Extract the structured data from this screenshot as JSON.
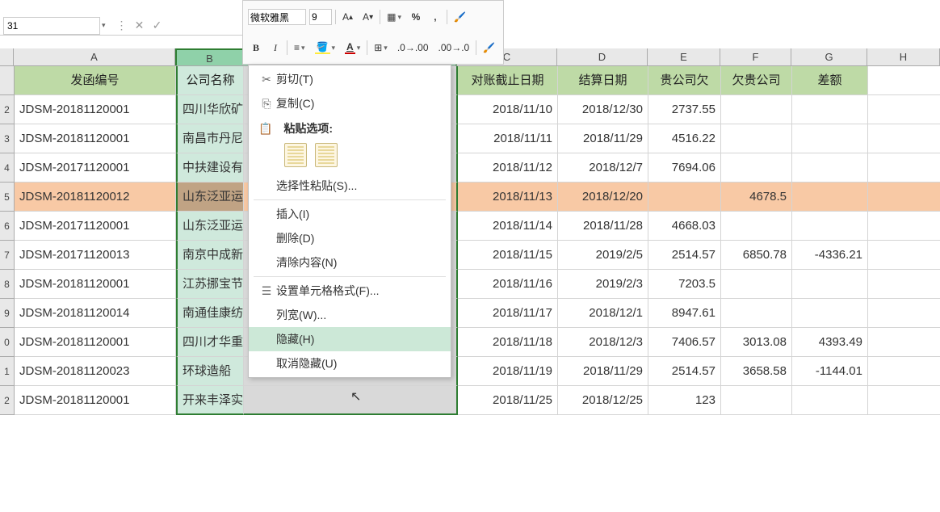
{
  "toolbar": {
    "font_name": "微软雅黑",
    "font_size": "9",
    "bold": "B",
    "italic": "I"
  },
  "namebox": {
    "value": "31"
  },
  "columns": [
    "A",
    "B",
    "C",
    "D",
    "E",
    "F",
    "G",
    "H"
  ],
  "header_row": {
    "A": "发函编号",
    "B": "公司名称",
    "C": "对账截止日期",
    "D": "结算日期",
    "E": "贵公司欠",
    "F": "欠贵公司",
    "G": "差额"
  },
  "rows": [
    {
      "rn": "2",
      "A": "JDSM-20181120001",
      "B": "四川华欣矿",
      "C": "2018/11/10",
      "D": "2018/12/30",
      "E": "2737.55",
      "F": "",
      "G": ""
    },
    {
      "rn": "3",
      "A": "JDSM-20181120001",
      "B": "南昌市丹尼",
      "C": "2018/11/11",
      "D": "2018/11/29",
      "E": "4516.22",
      "F": "",
      "G": ""
    },
    {
      "rn": "4",
      "A": "JDSM-20171120001",
      "B": "中扶建设有",
      "C": "2018/11/12",
      "D": "2018/12/7",
      "E": "7694.06",
      "F": "",
      "G": ""
    },
    {
      "rn": "5",
      "A": "JDSM-20181120012",
      "B": "山东泛亚运",
      "C": "2018/11/13",
      "D": "2018/12/20",
      "E": "",
      "F": "4678.5",
      "G": "",
      "orange": true
    },
    {
      "rn": "6",
      "A": "JDSM-20171120001",
      "B": "山东泛亚运",
      "C": "2018/11/14",
      "D": "2018/11/28",
      "E": "4668.03",
      "F": "",
      "G": ""
    },
    {
      "rn": "7",
      "A": "JDSM-20171120013",
      "B": "南京中成新",
      "C": "2018/11/15",
      "D": "2019/2/5",
      "E": "2514.57",
      "F": "6850.78",
      "G": "-4336.21"
    },
    {
      "rn": "8",
      "A": "JDSM-20181120001",
      "B": "江苏挪宝节",
      "C": "2018/11/16",
      "D": "2019/2/3",
      "E": "7203.5",
      "F": "",
      "G": ""
    },
    {
      "rn": "9",
      "A": "JDSM-20181120014",
      "B": "南通佳康纺",
      "C": "2018/11/17",
      "D": "2018/12/1",
      "E": "8947.61",
      "F": "",
      "G": ""
    },
    {
      "rn": "0",
      "A": "JDSM-20181120001",
      "B": "四川才华重",
      "C": "2018/11/18",
      "D": "2018/12/3",
      "E": "7406.57",
      "F": "3013.08",
      "G": "4393.49"
    },
    {
      "rn": "1",
      "A": "JDSM-20181120023",
      "B": "环球造船",
      "C": "2018/11/19",
      "D": "2018/11/29",
      "E": "2514.57",
      "F": "3658.58",
      "G": "-1144.01"
    },
    {
      "rn": "2",
      "A": "JDSM-20181120001",
      "B": "开来丰泽实",
      "C": "2018/11/25",
      "D": "2018/12/25",
      "E": "123",
      "F": "",
      "G": ""
    }
  ],
  "context_menu": {
    "cut": "剪切(T)",
    "copy": "复制(C)",
    "paste_options_header": "粘贴选项:",
    "paste_special": "选择性粘贴(S)...",
    "insert": "插入(I)",
    "delete": "删除(D)",
    "clear": "清除内容(N)",
    "format_cells": "设置单元格格式(F)...",
    "col_width": "列宽(W)...",
    "hide": "隐藏(H)",
    "unhide": "取消隐藏(U)"
  }
}
